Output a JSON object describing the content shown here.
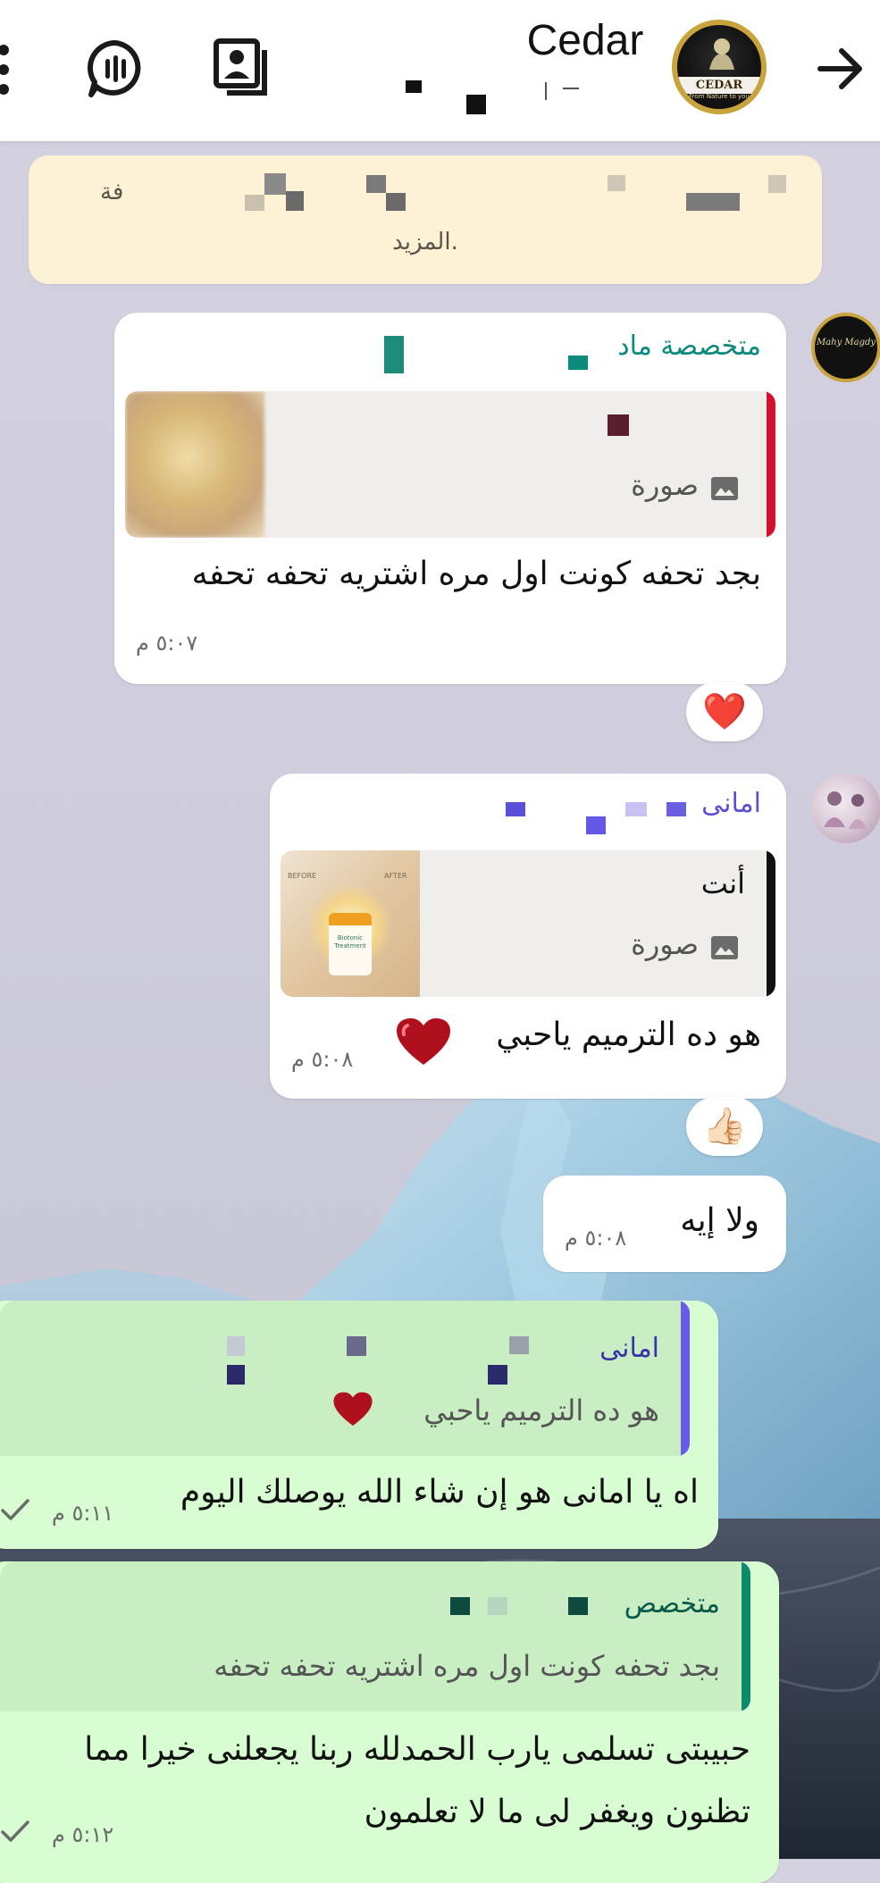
{
  "header": {
    "title": "Cedar",
    "back_icon": "arrow-right-icon",
    "icons": [
      "more-vertical-icon",
      "voice-chat-icon",
      "contact-card-icon"
    ],
    "avatar_logo": "CEDAR",
    "avatar_tagline": "From Nature to you"
  },
  "system_note": {
    "line1_fragment": "فة",
    "line2": "المزيد."
  },
  "messages": [
    {
      "sender": "متخصصة ماد",
      "reply_type_label": "صورة",
      "text": "بجد تحفه كونت اول مره اشتريه تحفه تحفه",
      "time": "٥:٠٧ م",
      "reaction": "❤️",
      "avatar_label": "Mahy Magdy"
    },
    {
      "sender": "امانى",
      "reply_author": "أنت",
      "reply_type_label": "صورة",
      "product_before": "BEFORE",
      "product_after": "AFTER",
      "product_name": "Biotonic Treatment",
      "text": "هو ده الترميم ياحبي",
      "time": "٥:٠٨ م",
      "reaction": "👍🏻"
    },
    {
      "text": "ولا إيه",
      "time": "٥:٠٨ م"
    },
    {
      "quote_author": "امانى",
      "quote_text": "هو ده الترميم ياحبي",
      "text": "اه يا امانى هو إن شاء الله يوصلك اليوم",
      "time": "٥:١١ م"
    },
    {
      "quote_author": "متخصص",
      "quote_text": "بجد تحفه كونت اول مره اشتريه تحفه تحفه",
      "text_line1": "حبيبتى تسلمى يارب الحمدلله ربنا يجعلنى خيرا مما",
      "text_line2": "تظنون ويغفر لى ما لا تعلمون",
      "time": "٥:١٢ م"
    }
  ],
  "colors": {
    "incoming_bubble": "#ffffff",
    "outgoing_bubble": "#d9fdd3",
    "system_note": "#fdf2d5",
    "sender_teal": "#0c8a7c",
    "sender_purple": "#5b4fd8",
    "reply_bar_red": "#d4102f",
    "reply_bar_black": "#111111"
  }
}
